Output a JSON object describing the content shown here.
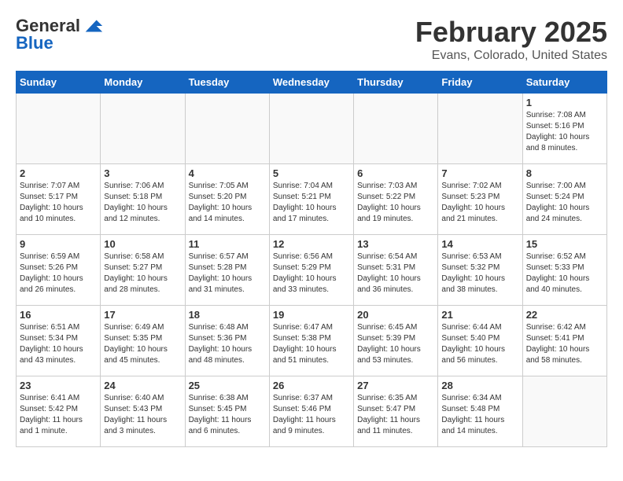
{
  "header": {
    "logo_line1": "General",
    "logo_line2": "Blue",
    "month": "February 2025",
    "location": "Evans, Colorado, United States"
  },
  "weekdays": [
    "Sunday",
    "Monday",
    "Tuesday",
    "Wednesday",
    "Thursday",
    "Friday",
    "Saturday"
  ],
  "weeks": [
    [
      {
        "day": "",
        "info": ""
      },
      {
        "day": "",
        "info": ""
      },
      {
        "day": "",
        "info": ""
      },
      {
        "day": "",
        "info": ""
      },
      {
        "day": "",
        "info": ""
      },
      {
        "day": "",
        "info": ""
      },
      {
        "day": "1",
        "info": "Sunrise: 7:08 AM\nSunset: 5:16 PM\nDaylight: 10 hours and 8 minutes."
      }
    ],
    [
      {
        "day": "2",
        "info": "Sunrise: 7:07 AM\nSunset: 5:17 PM\nDaylight: 10 hours and 10 minutes."
      },
      {
        "day": "3",
        "info": "Sunrise: 7:06 AM\nSunset: 5:18 PM\nDaylight: 10 hours and 12 minutes."
      },
      {
        "day": "4",
        "info": "Sunrise: 7:05 AM\nSunset: 5:20 PM\nDaylight: 10 hours and 14 minutes."
      },
      {
        "day": "5",
        "info": "Sunrise: 7:04 AM\nSunset: 5:21 PM\nDaylight: 10 hours and 17 minutes."
      },
      {
        "day": "6",
        "info": "Sunrise: 7:03 AM\nSunset: 5:22 PM\nDaylight: 10 hours and 19 minutes."
      },
      {
        "day": "7",
        "info": "Sunrise: 7:02 AM\nSunset: 5:23 PM\nDaylight: 10 hours and 21 minutes."
      },
      {
        "day": "8",
        "info": "Sunrise: 7:00 AM\nSunset: 5:24 PM\nDaylight: 10 hours and 24 minutes."
      }
    ],
    [
      {
        "day": "9",
        "info": "Sunrise: 6:59 AM\nSunset: 5:26 PM\nDaylight: 10 hours and 26 minutes."
      },
      {
        "day": "10",
        "info": "Sunrise: 6:58 AM\nSunset: 5:27 PM\nDaylight: 10 hours and 28 minutes."
      },
      {
        "day": "11",
        "info": "Sunrise: 6:57 AM\nSunset: 5:28 PM\nDaylight: 10 hours and 31 minutes."
      },
      {
        "day": "12",
        "info": "Sunrise: 6:56 AM\nSunset: 5:29 PM\nDaylight: 10 hours and 33 minutes."
      },
      {
        "day": "13",
        "info": "Sunrise: 6:54 AM\nSunset: 5:31 PM\nDaylight: 10 hours and 36 minutes."
      },
      {
        "day": "14",
        "info": "Sunrise: 6:53 AM\nSunset: 5:32 PM\nDaylight: 10 hours and 38 minutes."
      },
      {
        "day": "15",
        "info": "Sunrise: 6:52 AM\nSunset: 5:33 PM\nDaylight: 10 hours and 40 minutes."
      }
    ],
    [
      {
        "day": "16",
        "info": "Sunrise: 6:51 AM\nSunset: 5:34 PM\nDaylight: 10 hours and 43 minutes."
      },
      {
        "day": "17",
        "info": "Sunrise: 6:49 AM\nSunset: 5:35 PM\nDaylight: 10 hours and 45 minutes."
      },
      {
        "day": "18",
        "info": "Sunrise: 6:48 AM\nSunset: 5:36 PM\nDaylight: 10 hours and 48 minutes."
      },
      {
        "day": "19",
        "info": "Sunrise: 6:47 AM\nSunset: 5:38 PM\nDaylight: 10 hours and 51 minutes."
      },
      {
        "day": "20",
        "info": "Sunrise: 6:45 AM\nSunset: 5:39 PM\nDaylight: 10 hours and 53 minutes."
      },
      {
        "day": "21",
        "info": "Sunrise: 6:44 AM\nSunset: 5:40 PM\nDaylight: 10 hours and 56 minutes."
      },
      {
        "day": "22",
        "info": "Sunrise: 6:42 AM\nSunset: 5:41 PM\nDaylight: 10 hours and 58 minutes."
      }
    ],
    [
      {
        "day": "23",
        "info": "Sunrise: 6:41 AM\nSunset: 5:42 PM\nDaylight: 11 hours and 1 minute."
      },
      {
        "day": "24",
        "info": "Sunrise: 6:40 AM\nSunset: 5:43 PM\nDaylight: 11 hours and 3 minutes."
      },
      {
        "day": "25",
        "info": "Sunrise: 6:38 AM\nSunset: 5:45 PM\nDaylight: 11 hours and 6 minutes."
      },
      {
        "day": "26",
        "info": "Sunrise: 6:37 AM\nSunset: 5:46 PM\nDaylight: 11 hours and 9 minutes."
      },
      {
        "day": "27",
        "info": "Sunrise: 6:35 AM\nSunset: 5:47 PM\nDaylight: 11 hours and 11 minutes."
      },
      {
        "day": "28",
        "info": "Sunrise: 6:34 AM\nSunset: 5:48 PM\nDaylight: 11 hours and 14 minutes."
      },
      {
        "day": "",
        "info": ""
      }
    ]
  ]
}
